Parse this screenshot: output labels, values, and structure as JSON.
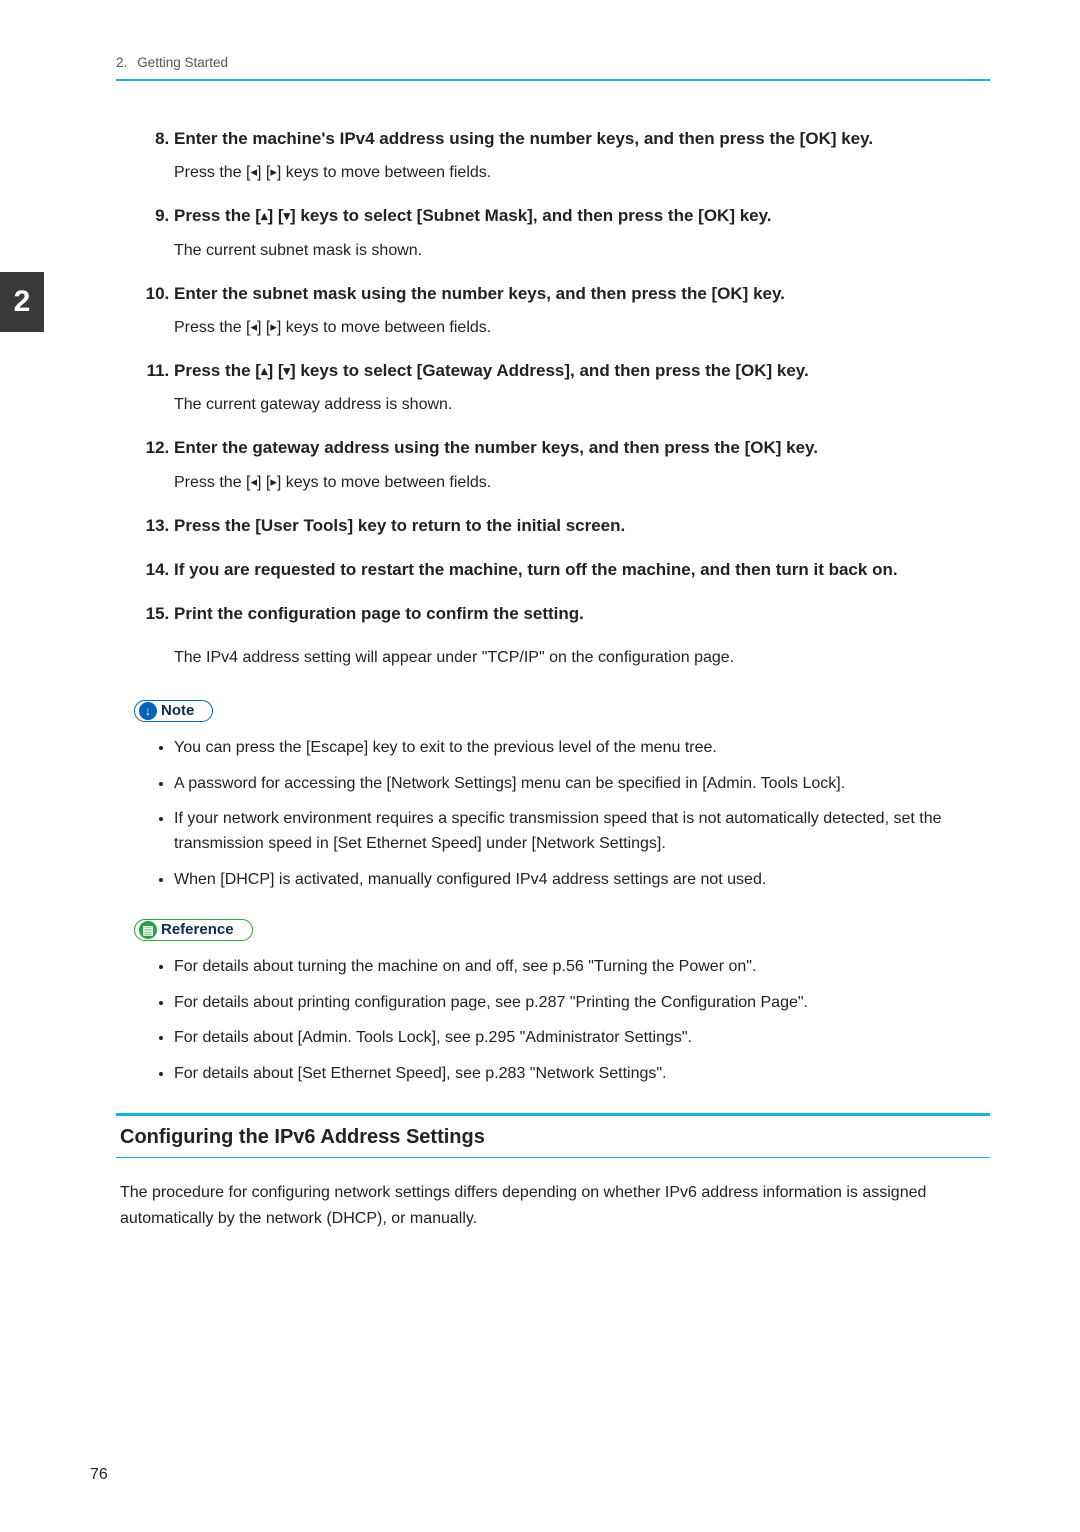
{
  "chapter": {
    "prefix": "2.",
    "title": "Getting Started"
  },
  "tab": "2",
  "arrows": {
    "left": "◂",
    "right": "▸",
    "up": "▴",
    "down": "▾"
  },
  "steps": {
    "s8": {
      "head": "Enter the machine's IPv4 address using the number keys, and then press the [OK] key.",
      "body_pre": "Press the [",
      "body_mid": "] [",
      "body_post": "] keys to move between fields."
    },
    "s9": {
      "head_pre": "Press the [",
      "head_mid": "] [",
      "head_post": "] keys to select [Subnet Mask], and then press the [OK] key.",
      "body": "The current subnet mask is shown."
    },
    "s10": {
      "head": "Enter the subnet mask using the number keys, and then press the [OK] key.",
      "body_pre": "Press the [",
      "body_mid": "] [",
      "body_post": "] keys to move between fields."
    },
    "s11": {
      "head_pre": "Press the [",
      "head_mid": "] [",
      "head_post": "] keys to select [Gateway Address], and then press the [OK] key.",
      "body": "The current gateway address is shown."
    },
    "s12": {
      "head": "Enter the gateway address using the number keys, and then press the [OK] key.",
      "body_pre": "Press the [",
      "body_mid": "] [",
      "body_post": "] keys to move between fields."
    },
    "s13": {
      "head": "Press the [User Tools] key to return to the initial screen."
    },
    "s14": {
      "head": "If you are requested to restart the machine, turn off the machine, and then turn it back on."
    },
    "s15": {
      "head": "Print the configuration page to confirm the setting."
    }
  },
  "after_steps": "The IPv4 address setting will appear under \"TCP/IP\" on the configuration page.",
  "note_label": "Note",
  "notes": [
    "You can press the [Escape] key to exit to the previous level of the menu tree.",
    "A password for accessing the [Network Settings] menu can be specified in [Admin. Tools Lock].",
    "If your network environment requires a specific transmission speed that is not automatically detected, set the transmission speed in [Set Ethernet Speed] under [Network Settings].",
    "When [DHCP] is activated, manually configured IPv4 address settings are not used."
  ],
  "ref_label": "Reference",
  "refs": [
    "For details about turning the machine on and off, see p.56 \"Turning the Power on\".",
    "For details about printing configuration page, see p.287 \"Printing the Configuration Page\".",
    "For details about [Admin. Tools Lock], see p.295 \"Administrator Settings\".",
    "For details about [Set Ethernet Speed], see p.283 \"Network Settings\"."
  ],
  "section": {
    "title": "Configuring the IPv6 Address Settings",
    "para": "The procedure for configuring network settings differs depending on whether IPv6 address information is assigned automatically by the network (DHCP), or manually."
  },
  "page_number": "76"
}
